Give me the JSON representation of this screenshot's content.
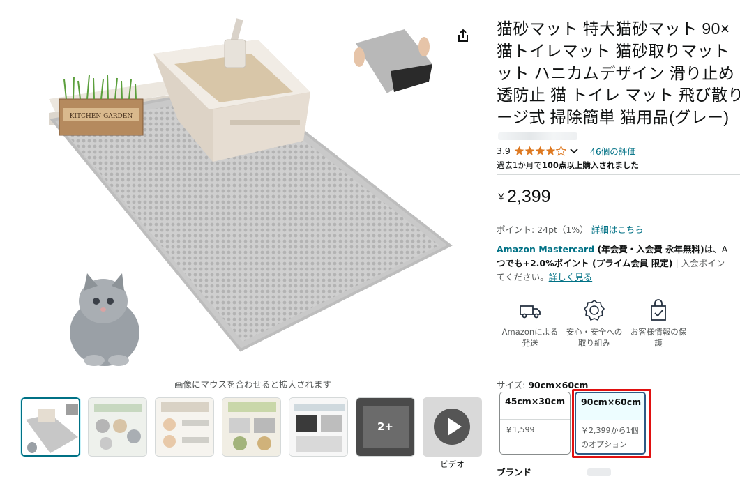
{
  "gallery": {
    "zoom_hint": "画像にマウスを合わせると拡大されます",
    "main_image_sign": "KITCHEN GARDEN",
    "more_thumbnails_label": "2+",
    "video_label": "ビデオ",
    "thumbnail_count": 7
  },
  "product": {
    "title_lines": [
      "猫砂マット 特大猫砂マット 90×",
      "猫トイレマット 猫砂取りマット",
      "ット ハニカムデザイン 滑り止め",
      "透防止 猫 トイレ マット 飛び散り",
      "ージ式 掃除簡単 猫用品(グレー)"
    ],
    "rating_value": "3.9",
    "rating_stars": 3.9,
    "reviews_count": "46個の評価",
    "bought_prefix": "過去1か月で",
    "bought_bold": "100点以上購入されました",
    "price_symbol": "￥",
    "price_value": "2,399",
    "points_text": "ポイント: 24pt（1%）",
    "points_link": "詳細はこちら"
  },
  "promo": {
    "card_name": "Amazon Mastercard",
    "card_fee": " (年会費・入会費 永年無料)",
    "card_mid": "は、A",
    "line2_bold": "つでも+2.0%ポイント (プライム会員 限定)",
    "line2_tail": " | 入会ポイン",
    "line3_text": "てください。",
    "line3_link": "詳しく見る"
  },
  "features": [
    {
      "icon": "truck-icon",
      "label_line1": "Amazonによる",
      "label_line2": "発送"
    },
    {
      "icon": "shield-badge-icon",
      "label_line1": "安心・安全への",
      "label_line2": "取り組み"
    },
    {
      "icon": "secure-bag-icon",
      "label_line1": "お客様情報の保",
      "label_line2": "護"
    }
  ],
  "size": {
    "label": "サイズ: ",
    "selected_value": "90cm×60cm",
    "options": [
      {
        "title": "45cm×30cm",
        "price": "￥1,599"
      },
      {
        "title": "90cm×60cm",
        "price": "￥2,399から1個のオプション"
      }
    ]
  },
  "brand": {
    "label": "ブランド"
  },
  "colors": {
    "link": "#007185",
    "star": "#de7921",
    "highlight": "#e01010",
    "selected_border": "#2e5a85",
    "thumb_selected": "#007185"
  }
}
